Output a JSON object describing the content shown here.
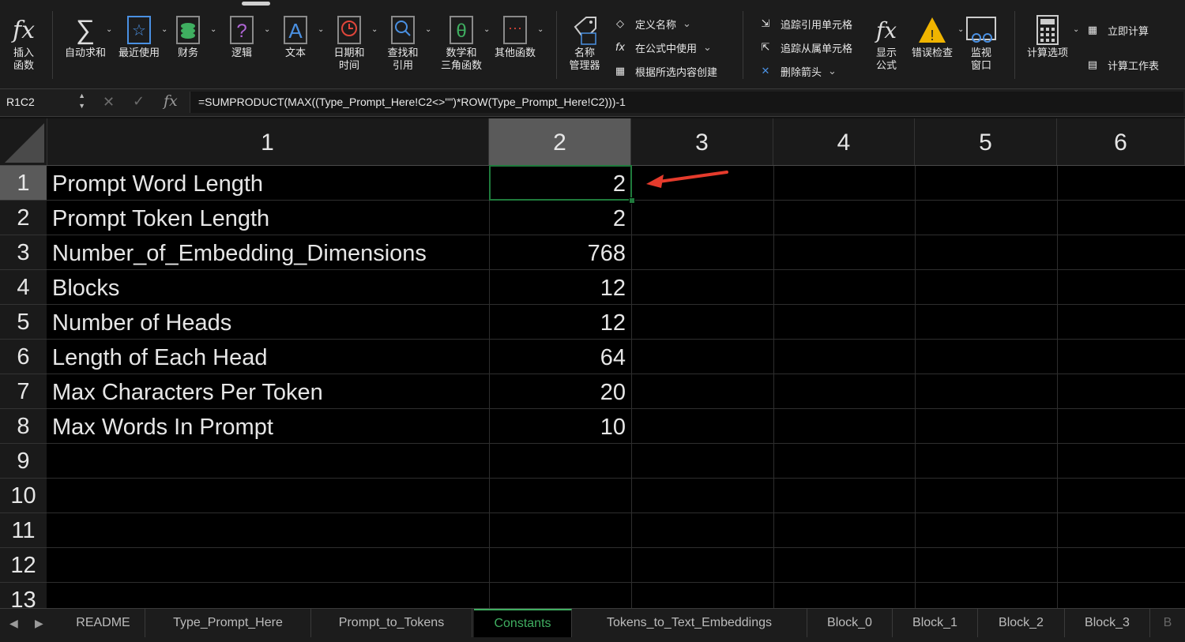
{
  "ribbon": {
    "insert_function": "插入\n函数",
    "autosum": "自动求和",
    "recent": "最近使用",
    "financial": "财务",
    "logical": "逻辑",
    "text": "文本",
    "datetime": "日期和\n时间",
    "lookup": "查找和\n引用",
    "math": "数学和\n三角函数",
    "more": "其他函数",
    "name_manager": "名称\n管理器",
    "define_name": "定义名称",
    "use_in_formula": "在公式中使用",
    "create_from_selection": "根据所选内容创建",
    "trace_precedents": "追踪引用单元格",
    "trace_dependents": "追踪从属单元格",
    "remove_arrows": "删除箭头",
    "show_formulas": "显示\n公式",
    "error_checking": "错误检查",
    "watch_window": "监视\n窗口",
    "calc_options": "计算选项",
    "calc_now": "立即计算",
    "calc_sheet": "计算工作表"
  },
  "formula_bar": {
    "name_box": "R1C2",
    "fx": "fx",
    "formula": "=SUMPRODUCT(MAX((Type_Prompt_Here!C2<>\"\")*ROW(Type_Prompt_Here!C2)))-1"
  },
  "columns": [
    "1",
    "2",
    "3",
    "4",
    "5",
    "6"
  ],
  "rows": [
    "1",
    "2",
    "3",
    "4",
    "5",
    "6",
    "7",
    "8",
    "9",
    "10",
    "11",
    "12",
    "13"
  ],
  "cells": [
    {
      "label": "Prompt Word Length",
      "value": "2"
    },
    {
      "label": "Prompt Token Length",
      "value": "2"
    },
    {
      "label": "Number_of_Embedding_Dimensions",
      "value": "768"
    },
    {
      "label": "Blocks",
      "value": "12"
    },
    {
      "label": "Number of Heads",
      "value": "12"
    },
    {
      "label": "Length of Each Head",
      "value": "64"
    },
    {
      "label": "Max Characters Per Token",
      "value": "20"
    },
    {
      "label": "Max Words In Prompt",
      "value": "10"
    }
  ],
  "sheet_tabs": [
    "README",
    "Type_Prompt_Here",
    "Prompt_to_Tokens",
    "Constants",
    "Tokens_to_Text_Embeddings",
    "Block_0",
    "Block_1",
    "Block_2",
    "Block_3",
    "B"
  ],
  "active_tab": "Constants",
  "colors": {
    "accent_green": "#1f7a3c",
    "tab_green": "#3fae60",
    "annotation_arrow": "#e53b2c"
  }
}
